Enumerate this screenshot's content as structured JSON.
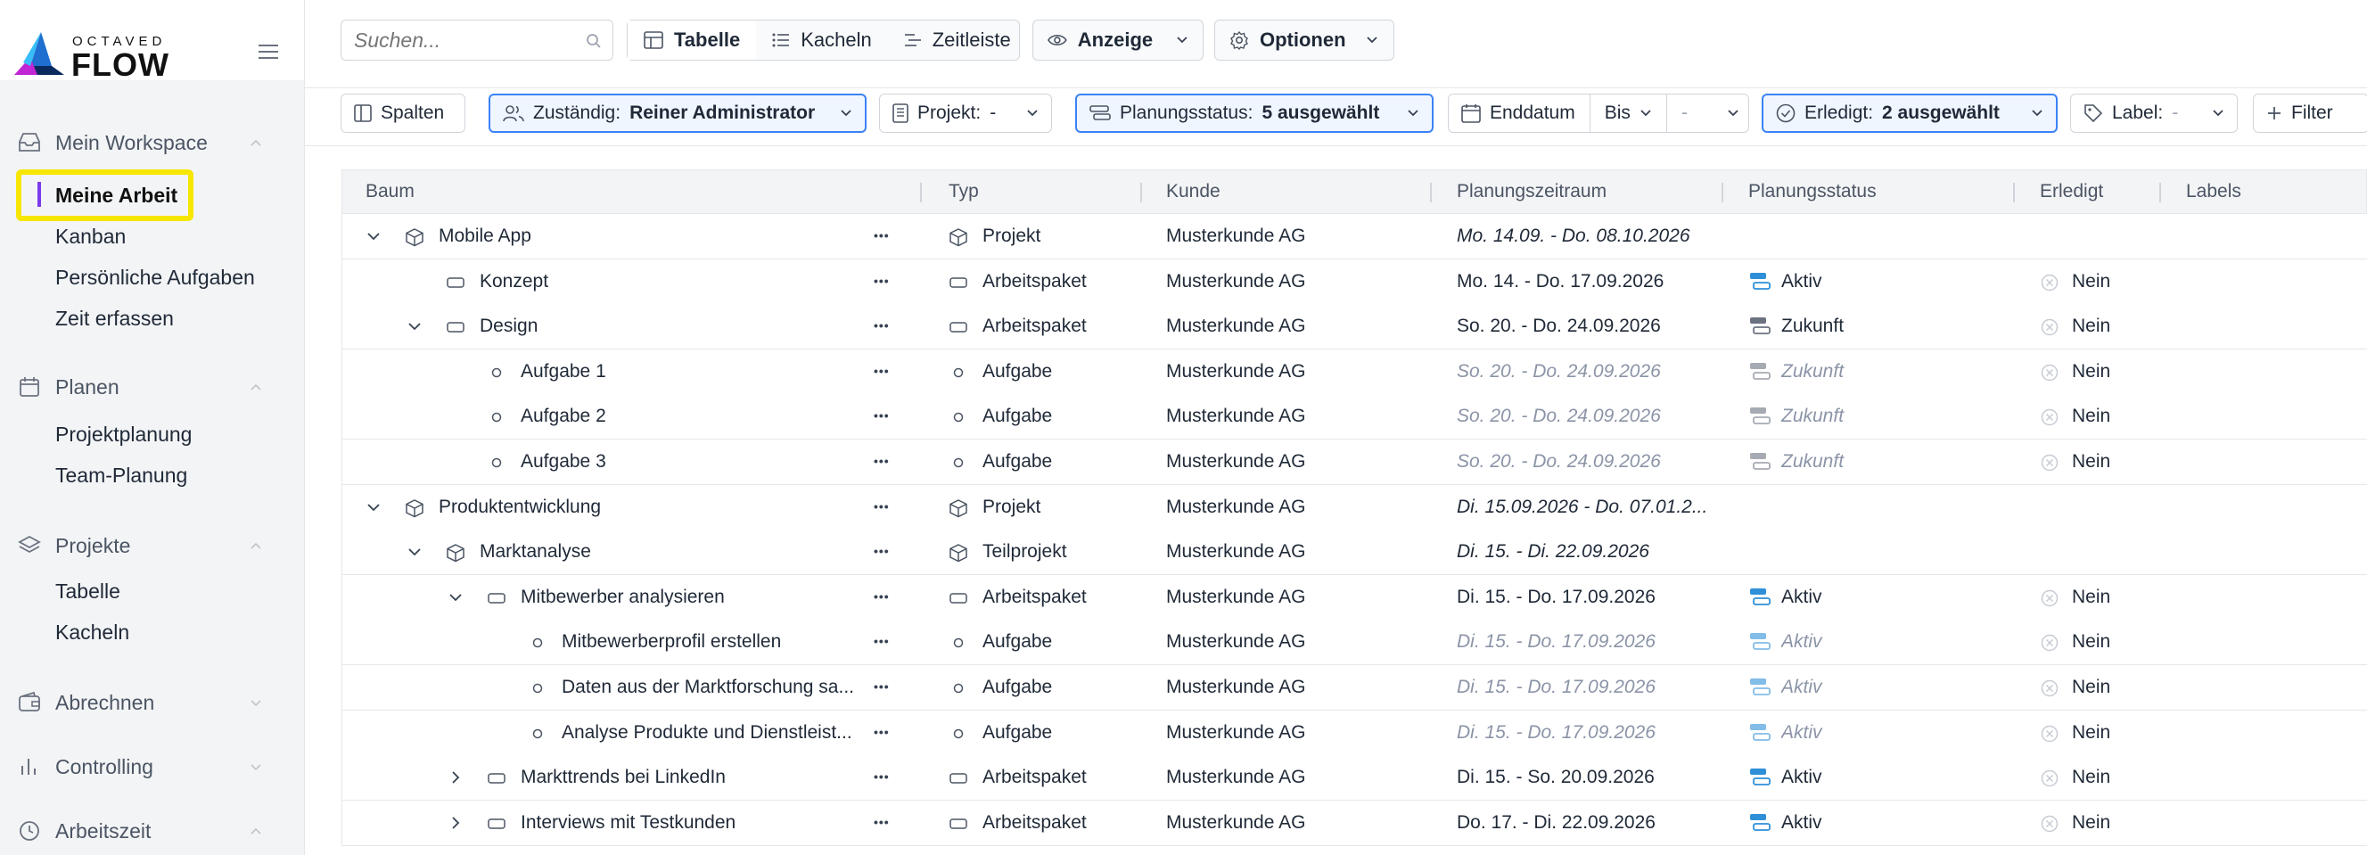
{
  "brand": {
    "top": "OCTAVED",
    "name": "FLOW"
  },
  "sidebar": {
    "sections": [
      {
        "label": "Mein Workspace",
        "icon": "inbox-icon",
        "expanded": true,
        "items": [
          "Meine Arbeit",
          "Kanban",
          "Persönliche Aufgaben",
          "Zeit erfassen"
        ]
      },
      {
        "label": "Planen",
        "icon": "calendar-icon",
        "expanded": true,
        "items": [
          "Projektplanung",
          "Team-Planung"
        ]
      },
      {
        "label": "Projekte",
        "icon": "layers-icon",
        "expanded": true,
        "items": [
          "Tabelle",
          "Kacheln"
        ]
      },
      {
        "label": "Abrechnen",
        "icon": "wallet-icon",
        "expanded": false,
        "items": []
      },
      {
        "label": "Controlling",
        "icon": "bar-chart-icon",
        "expanded": false,
        "items": []
      },
      {
        "label": "Arbeitszeit",
        "icon": "clock-icon",
        "expanded": true,
        "items": []
      }
    ],
    "active_item": "Meine Arbeit"
  },
  "toolbar": {
    "search_placeholder": "Suchen...",
    "views": [
      "Tabelle",
      "Kacheln",
      "Zeitleiste"
    ],
    "selected_view": "Tabelle",
    "display_label": "Anzeige",
    "options_label": "Optionen"
  },
  "filters": {
    "columns_label": "Spalten",
    "assignee_label": "Zuständig:",
    "assignee_value": "Reiner Administrator",
    "project_label": "Projekt:",
    "project_value": "-",
    "planning_status_label": "Planungsstatus:",
    "planning_status_value": "5 ausgewählt",
    "end_date_label": "Enddatum",
    "end_date_op": "Bis",
    "end_date_value": "-",
    "done_label": "Erledigt:",
    "done_value": "2 ausgewählt",
    "label_label": "Label:",
    "label_value": "-",
    "add_filter_label": "Filter"
  },
  "table": {
    "columns": [
      "Baum",
      "Typ",
      "Kunde",
      "Planungszeitraum",
      "Planungsstatus",
      "Erledigt",
      "Labels"
    ],
    "rows": [
      {
        "depth": 0,
        "toggle": "open",
        "kind": "project",
        "name": "Mobile App",
        "type": "Projekt",
        "customer": "Musterkunde AG",
        "period": "Mo. 14.09. - Do. 08.10.2026",
        "period_style": "italic",
        "status": "",
        "status_style": "",
        "done": ""
      },
      {
        "depth": 1,
        "toggle": "none",
        "kind": "package",
        "name": "Konzept",
        "type": "Arbeitspaket",
        "customer": "Musterkunde AG",
        "period": "Mo. 14. - Do. 17.09.2026",
        "period_style": "normal",
        "status": "Aktiv",
        "status_style": "normal",
        "done": "Nein"
      },
      {
        "depth": 1,
        "toggle": "open",
        "kind": "package",
        "name": "Design",
        "type": "Arbeitspaket",
        "customer": "Musterkunde AG",
        "period": "So. 20. - Do. 24.09.2026",
        "period_style": "normal",
        "status": "Zukunft",
        "status_style": "normal",
        "done": "Nein"
      },
      {
        "depth": 2,
        "toggle": "none",
        "kind": "task",
        "name": "Aufgabe 1",
        "type": "Aufgabe",
        "customer": "Musterkunde AG",
        "period": "So. 20. - Do. 24.09.2026",
        "period_style": "muted",
        "status": "Zukunft",
        "status_style": "muted",
        "done": "Nein"
      },
      {
        "depth": 2,
        "toggle": "none",
        "kind": "task",
        "name": "Aufgabe 2",
        "type": "Aufgabe",
        "customer": "Musterkunde AG",
        "period": "So. 20. - Do. 24.09.2026",
        "period_style": "muted",
        "status": "Zukunft",
        "status_style": "muted",
        "done": "Nein"
      },
      {
        "depth": 2,
        "toggle": "none",
        "kind": "task",
        "name": "Aufgabe 3",
        "type": "Aufgabe",
        "customer": "Musterkunde AG",
        "period": "So. 20. - Do. 24.09.2026",
        "period_style": "muted",
        "status": "Zukunft",
        "status_style": "muted",
        "done": "Nein"
      },
      {
        "depth": 0,
        "toggle": "open",
        "kind": "project",
        "name": "Produktentwicklung",
        "type": "Projekt",
        "customer": "Musterkunde AG",
        "period": "Di. 15.09.2026 - Do. 07.01.2...",
        "period_style": "italic",
        "status": "",
        "status_style": "",
        "done": ""
      },
      {
        "depth": 1,
        "toggle": "open",
        "kind": "project",
        "name": "Marktanalyse",
        "type": "Teilprojekt",
        "customer": "Musterkunde AG",
        "period": "Di. 15. - Di. 22.09.2026",
        "period_style": "italic",
        "status": "",
        "status_style": "",
        "done": ""
      },
      {
        "depth": 2,
        "toggle": "open",
        "kind": "package",
        "name": "Mitbewerber analysieren",
        "type": "Arbeitspaket",
        "customer": "Musterkunde AG",
        "period": "Di. 15. - Do. 17.09.2026",
        "period_style": "normal",
        "status": "Aktiv",
        "status_style": "normal",
        "done": "Nein"
      },
      {
        "depth": 3,
        "toggle": "none",
        "kind": "task",
        "name": "Mitbewerberprofil erstellen",
        "type": "Aufgabe",
        "customer": "Musterkunde AG",
        "period": "Di. 15. - Do. 17.09.2026",
        "period_style": "muted",
        "status": "Aktiv",
        "status_style": "muted",
        "done": "Nein"
      },
      {
        "depth": 3,
        "toggle": "none",
        "kind": "task",
        "name": "Daten aus der Marktforschung sa...",
        "type": "Aufgabe",
        "customer": "Musterkunde AG",
        "period": "Di. 15. - Do. 17.09.2026",
        "period_style": "muted",
        "status": "Aktiv",
        "status_style": "muted",
        "done": "Nein"
      },
      {
        "depth": 3,
        "toggle": "none",
        "kind": "task",
        "name": "Analyse Produkte und Dienstleist...",
        "type": "Aufgabe",
        "customer": "Musterkunde AG",
        "period": "Di. 15. - Do. 17.09.2026",
        "period_style": "muted",
        "status": "Aktiv",
        "status_style": "muted",
        "done": "Nein"
      },
      {
        "depth": 2,
        "toggle": "closed",
        "kind": "package",
        "name": "Markttrends bei LinkedIn",
        "type": "Arbeitspaket",
        "customer": "Musterkunde AG",
        "period": "Di. 15. - So. 20.09.2026",
        "period_style": "normal",
        "status": "Aktiv",
        "status_style": "normal",
        "done": "Nein"
      },
      {
        "depth": 2,
        "toggle": "closed",
        "kind": "package",
        "name": "Interviews mit Testkunden",
        "type": "Arbeitspaket",
        "customer": "Musterkunde AG",
        "period": "Do. 17. - Di. 22.09.2026",
        "period_style": "normal",
        "status": "Aktiv",
        "status_style": "normal",
        "done": "Nein"
      }
    ]
  },
  "colors": {
    "accent": "#3b82f6",
    "active_bar": "#7c3aed",
    "highlight": "#f7e600",
    "status_blue": "#2f8fd8"
  }
}
